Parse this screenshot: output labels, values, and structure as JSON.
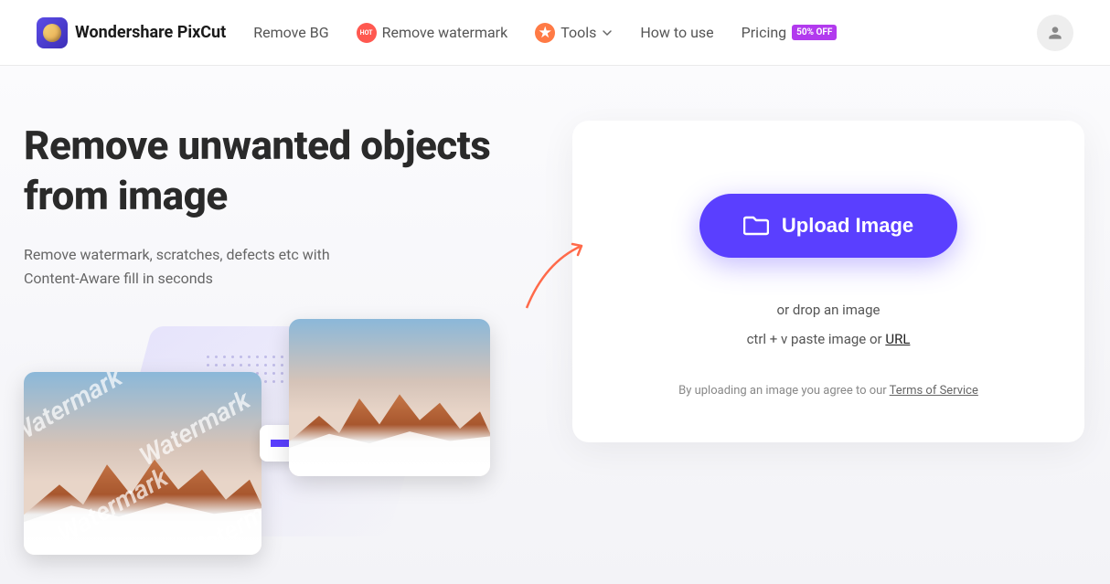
{
  "header": {
    "brand": "Wondershare PixCut",
    "nav": {
      "remove_bg": "Remove BG",
      "remove_watermark": "Remove watermark",
      "tools": "Tools",
      "how_to_use": "How to use",
      "pricing": "Pricing",
      "off_badge": "50% OFF",
      "hot_label": "HOT"
    }
  },
  "hero": {
    "title": "Remove unwanted objects from image",
    "subtitle": "Remove watermark, scratches, defects etc with Content-Aware fill in seconds",
    "watermark_text": "Watermark"
  },
  "upload": {
    "button_label": "Upload Image",
    "drop_text": "or drop an image",
    "paste_prefix": "ctrl + v paste image or ",
    "url_label": "URL",
    "tos_prefix": "By uploading an image you agree to our ",
    "tos_link": "Terms of Service"
  }
}
